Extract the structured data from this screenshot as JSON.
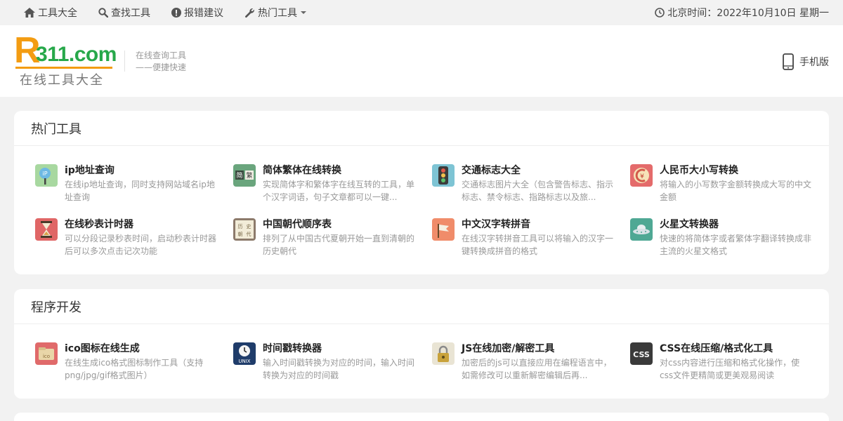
{
  "topnav": {
    "items": [
      {
        "label": "工具大全",
        "icon": "home-icon"
      },
      {
        "label": "查找工具",
        "icon": "search-icon"
      },
      {
        "label": "报错建议",
        "icon": "alert-icon"
      },
      {
        "label": "热门工具",
        "icon": "wrench-icon"
      }
    ],
    "clock": "北京时间：2022年10月10日 星期一"
  },
  "header": {
    "logo_r": "R",
    "logo_rest": "311.com",
    "logo_sub": "在线工具大全",
    "slogan_line1": "在线查询工具",
    "slogan_line2": "——便捷快速",
    "mobile_label": "手机版"
  },
  "sections": [
    {
      "title": "热门工具",
      "tools": [
        {
          "name": "ip地址查询",
          "desc": "在线ip地址查询，同时支持网站域名ip地址查询",
          "icon": "ip-pin-icon"
        },
        {
          "name": "简体繁体在线转换",
          "desc": "实现简体字和繁体字在线互转的工具，单个汉字词语，句子文章都可以一键...",
          "icon": "jian-fan-icon"
        },
        {
          "name": "交通标志大全",
          "desc": "交通标志图片大全（包含警告标志、指示标志、禁令标志、指路标志以及旅...",
          "icon": "traffic-light-icon"
        },
        {
          "name": "人民币大小写转换",
          "desc": "将输入的小写数字金额转换成大写的中文金额",
          "icon": "yuan-coin-icon"
        },
        {
          "name": "在线秒表计时器",
          "desc": "可以分段记录秒表时间，启动秒表计时器后可以多次点击记次功能",
          "icon": "hourglass-icon"
        },
        {
          "name": "中国朝代顺序表",
          "desc": "排列了从中国古代夏朝开始一直到清朝的历史朝代",
          "icon": "history-book-icon"
        },
        {
          "name": "中文汉字转拼音",
          "desc": "在线汉字转拼音工具可以将输入的汉字一键转换成拼音的格式",
          "icon": "flag-icon"
        },
        {
          "name": "火星文转换器",
          "desc": "快速的将简体字或者繁体字翻译转换成非主流的火星文格式",
          "icon": "ufo-icon"
        }
      ]
    },
    {
      "title": "程序开发",
      "tools": [
        {
          "name": "ico图标在线生成",
          "desc": "在线生成ico格式图标制作工具（支持png/jpg/gif格式图片）",
          "icon": "ico-folder-icon"
        },
        {
          "name": "时间戳转换器",
          "desc": "输入时间戳转换为对应的时间，输入时间转换为对应的时间戳",
          "icon": "unix-clock-icon"
        },
        {
          "name": "JS在线加密/解密工具",
          "desc": "加密后的js可以直接应用在编程语言中，如需修改可以重新解密编辑后再...",
          "icon": "padlock-icon"
        },
        {
          "name": "CSS在线压缩/格式化工具",
          "desc": "对css内容进行压缩和格式化操作，使css文件更精简或更美观易阅读",
          "icon": "css-icon"
        }
      ]
    }
  ]
}
